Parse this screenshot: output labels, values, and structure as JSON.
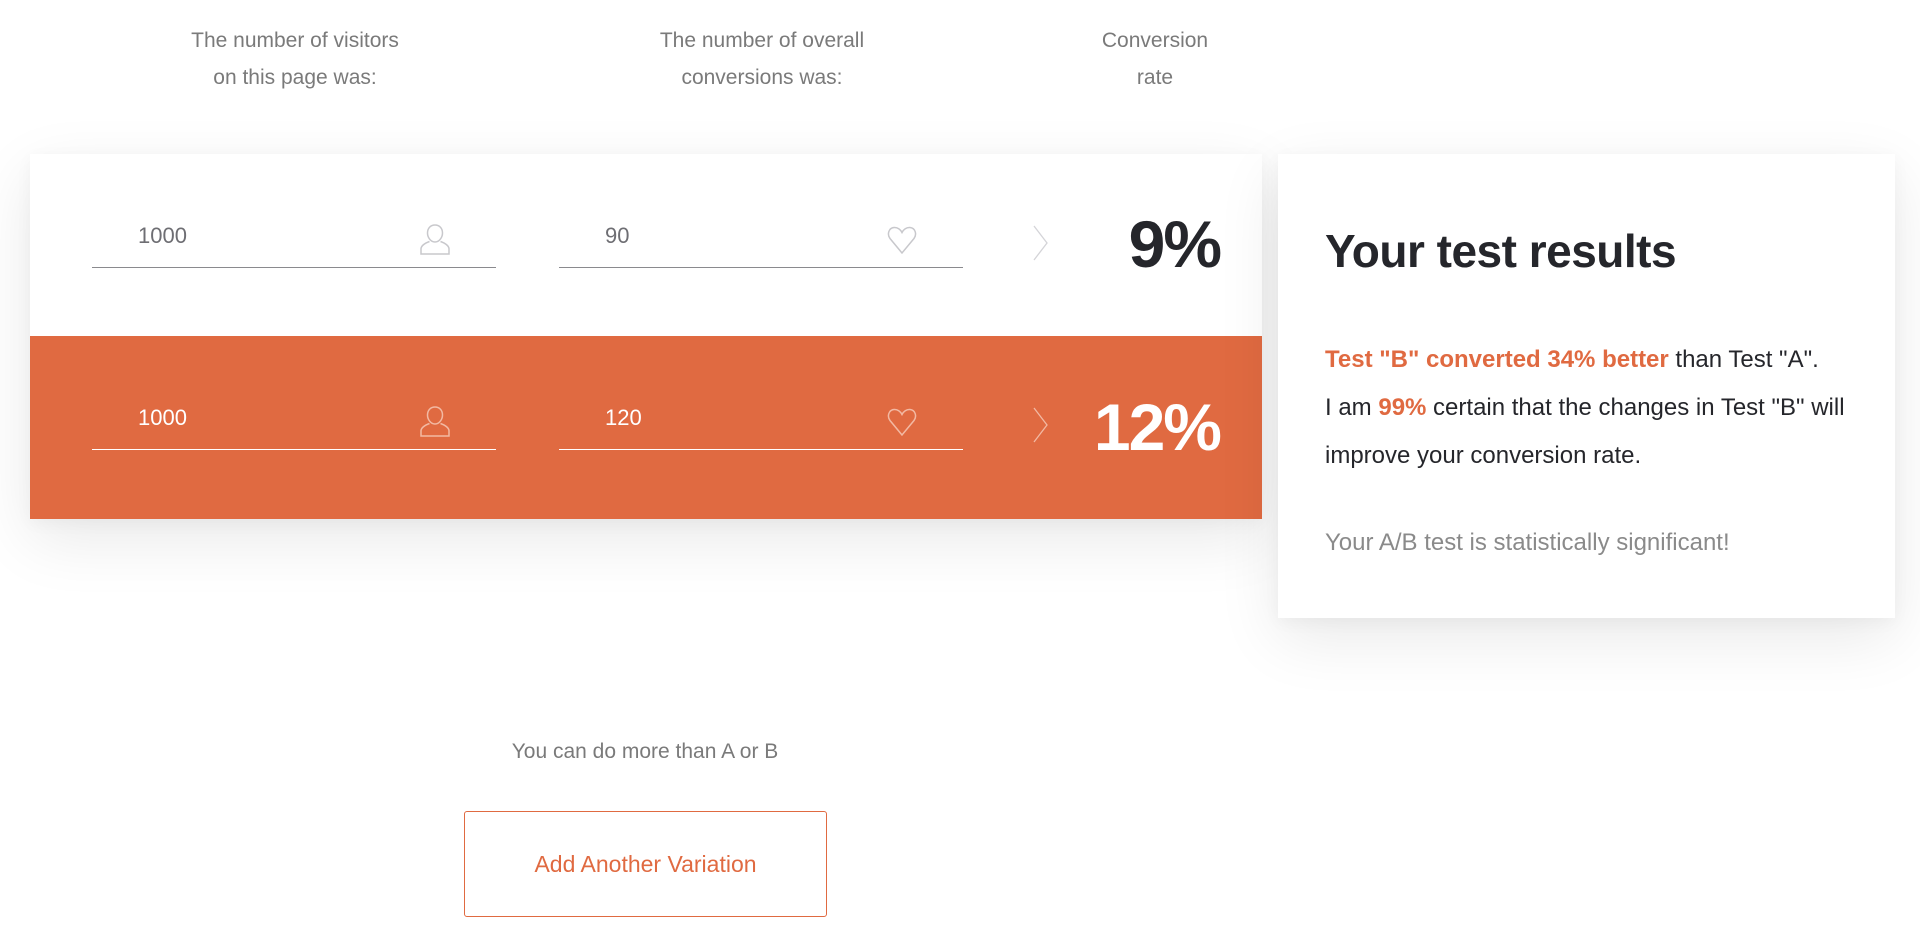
{
  "headers": {
    "visitors": {
      "line1": "The number of visitors",
      "line2": "on this page was:"
    },
    "conversions": {
      "line1": "The number of overall",
      "line2": "conversions was:"
    },
    "rate": {
      "line1": "Conversion",
      "line2": "rate"
    }
  },
  "variants": [
    {
      "name": "A",
      "visitors": "1000",
      "conversions": "90",
      "rate": "9%",
      "background_color": "#ffffff"
    },
    {
      "name": "B",
      "visitors": "1000",
      "conversions": "120",
      "rate": "12%",
      "background_color": "#e06a41"
    }
  ],
  "icons": {
    "visitors": "user-icon",
    "conversions": "heart-icon",
    "separator": "chevron-right-icon"
  },
  "results": {
    "title": "Your test results",
    "line1_highlight": "Test \"B\" converted 34% better",
    "line1_rest": " than Test \"A\".",
    "line2_prefix": "I am ",
    "line2_highlight": "99%",
    "line2_rest": " certain that the changes in Test \"B\" will improve your conversion rate.",
    "significance": "Your A/B test is statistically significant!"
  },
  "footer": {
    "more_text": "You can do more than A or B",
    "add_button_label": "Add Another Variation"
  },
  "colors": {
    "accent": "#e06a41",
    "text_dark": "#25262b",
    "text_muted": "#7a7a7a"
  }
}
